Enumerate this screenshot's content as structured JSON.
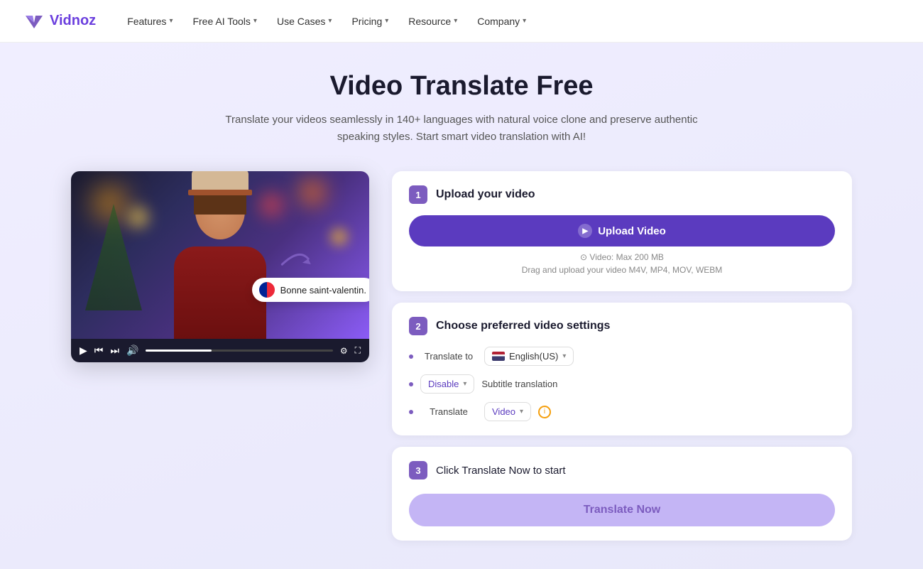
{
  "nav": {
    "logo_text": "Vidnoz",
    "items": [
      {
        "label": "Features",
        "has_chevron": true
      },
      {
        "label": "Free AI Tools",
        "has_chevron": true
      },
      {
        "label": "Use Cases",
        "has_chevron": true
      },
      {
        "label": "Pricing",
        "has_chevron": true
      },
      {
        "label": "Resource",
        "has_chevron": true
      },
      {
        "label": "Company",
        "has_chevron": true
      }
    ]
  },
  "hero": {
    "title": "Video Translate Free",
    "subtitle": "Translate your videos seamlessly in 140+ languages with natural voice clone and preserve authentic speaking styles. Start smart video translation with AI!"
  },
  "step1": {
    "num": "1",
    "title": "Upload your video",
    "upload_btn_label": "Upload Video",
    "video_info": "⊙ Video: Max 200 MB",
    "drag_info": "Drag and upload your video M4V, MP4, MOV, WEBM"
  },
  "step2": {
    "num": "2",
    "title": "Choose preferred video settings",
    "translate_to_label": "Translate to",
    "language_value": "English(US)",
    "disable_label": "Disable",
    "subtitle_label": "Subtitle translation",
    "translate_label": "Translate",
    "video_option": "Video"
  },
  "step3": {
    "num": "3",
    "title": "Click Translate Now to start",
    "btn_label": "Translate Now"
  },
  "subtitle_badge": {
    "text": "Bonne saint-valentin."
  }
}
